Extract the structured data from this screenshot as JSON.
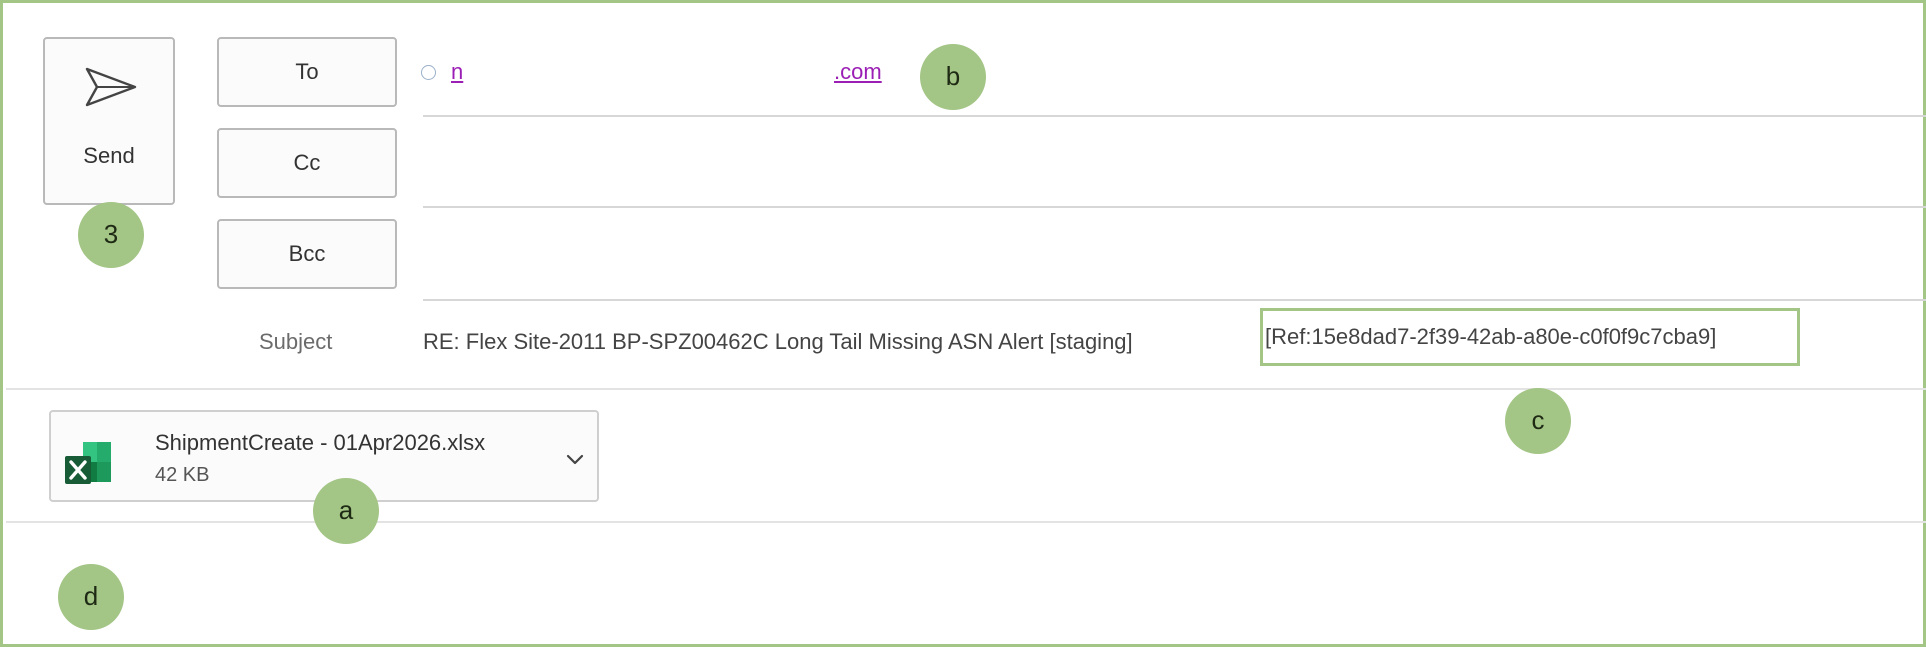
{
  "toolbar": {
    "send_label": "Send"
  },
  "recipients": {
    "to_label": "To",
    "cc_label": "Cc",
    "bcc_label": "Bcc",
    "to_value_prefix": "n",
    "to_value_suffix": ".com"
  },
  "subject": {
    "label": "Subject",
    "text": "RE: Flex Site-2011 BP-SPZ00462C Long Tail Missing ASN Alert [staging]",
    "ref": "[Ref:15e8dad7-2f39-42ab-a80e-c0f0f9c7cba9]"
  },
  "attachment": {
    "name": "ShipmentCreate - 01Apr2026.xlsx",
    "size": "42 KB",
    "icon": "excel-file-icon"
  },
  "annotations": {
    "a": "a",
    "b": "b",
    "c": "c",
    "d": "d",
    "send_step": "3"
  },
  "colors": {
    "annotation_green": "#a3c585",
    "link_purple": "#9b1fb5",
    "border_gray": "#b9b9b9"
  }
}
